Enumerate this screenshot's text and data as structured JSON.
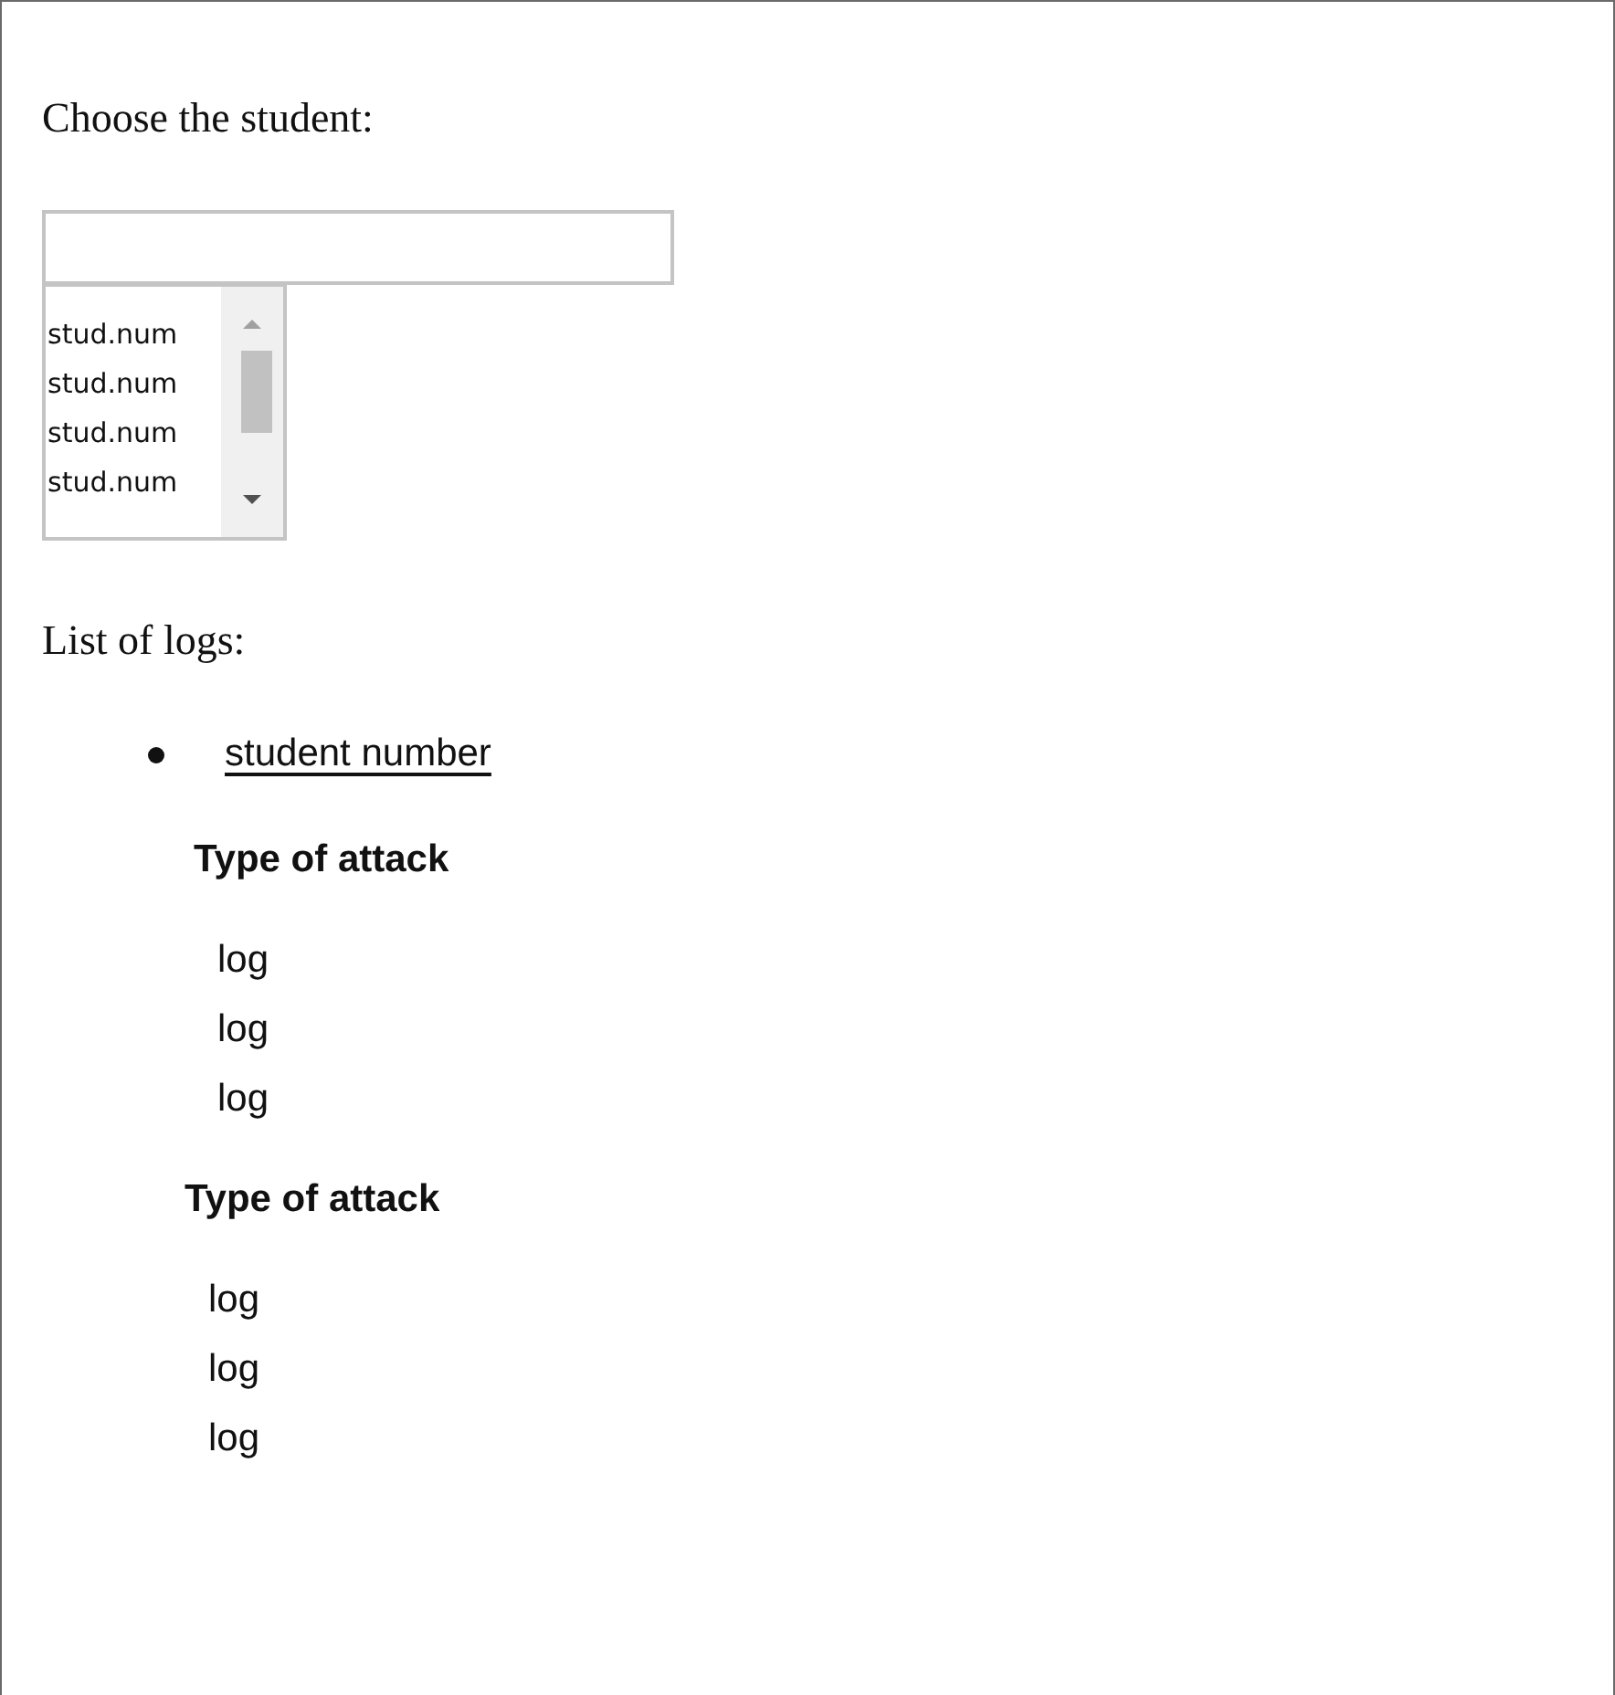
{
  "prompt": "Choose the student:",
  "student_list": {
    "options": [
      "stud.num",
      "stud.num",
      "stud.num",
      "stud.num"
    ]
  },
  "logs_heading": "List of logs:",
  "students": [
    {
      "link": "student number",
      "attacks": [
        {
          "title": "Type of attack",
          "logs": [
            "log",
            "log",
            "log"
          ]
        },
        {
          "title": "Type of attack",
          "logs": [
            "log",
            "log",
            "log"
          ]
        }
      ]
    }
  ]
}
